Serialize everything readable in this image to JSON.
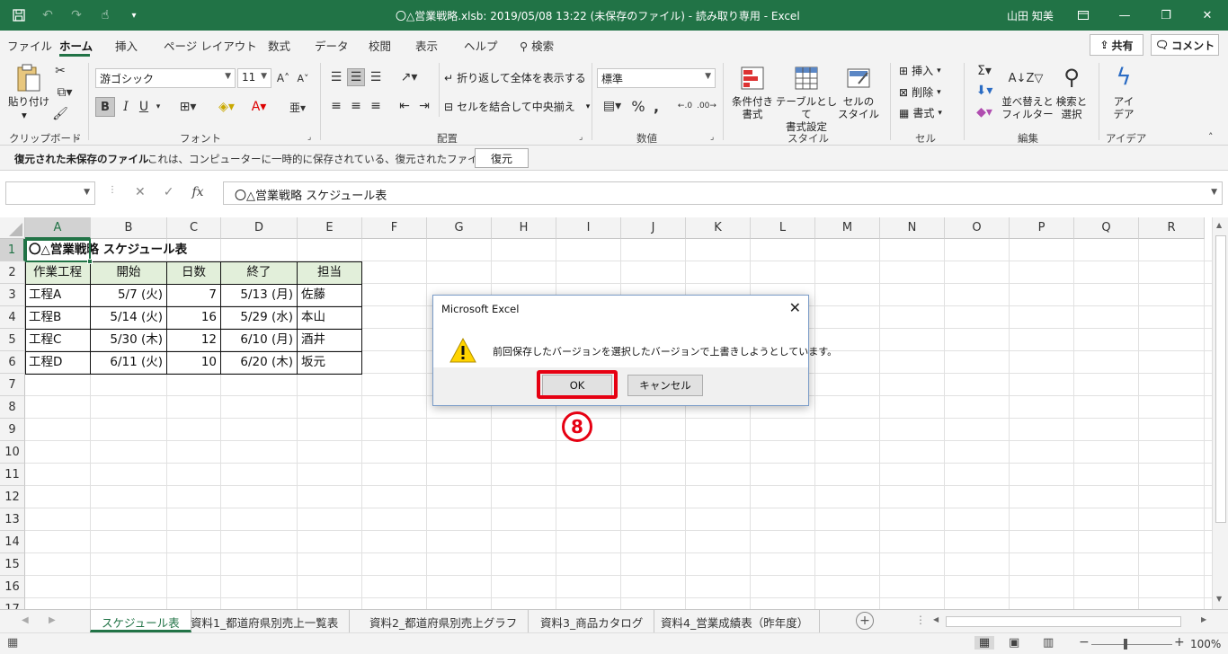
{
  "window": {
    "title": "〇△営業戦略.xlsb: 2019/05/08 13:22 (未保存のファイル) - 読み取り専用 - Excel",
    "user": "山田 知美"
  },
  "tabs": [
    "ファイル",
    "ホーム",
    "挿入",
    "ページ レイアウト",
    "数式",
    "データ",
    "校閲",
    "表示",
    "ヘルプ",
    "検索"
  ],
  "share_label": "共有",
  "comment_label": "コメント",
  "ribbon": {
    "clipboard": {
      "paste": "貼り付け",
      "group": "クリップボード"
    },
    "font": {
      "name": "游ゴシック",
      "size": "11",
      "group": "フォント",
      "bold": "B",
      "italic": "I",
      "underline": "U"
    },
    "alignment": {
      "wrap": "折り返して全体を表示する",
      "merge": "セルを結合して中央揃え",
      "group": "配置"
    },
    "number": {
      "format": "標準",
      "group": "数値"
    },
    "styles": {
      "conditional": "条件付き\n書式",
      "table": "テーブルとして\n書式設定",
      "cell": "セルの\nスタイル",
      "group": "スタイル"
    },
    "cells": {
      "insert": "挿入",
      "delete": "削除",
      "format": "書式",
      "group": "セル"
    },
    "editing": {
      "sort": "並べ替えと\nフィルター",
      "find": "検索と\n選択",
      "group": "編集"
    },
    "ideas": {
      "label": "アイ\nデア",
      "group": "アイデア"
    }
  },
  "infobar": {
    "title": "復元された未保存のファイル",
    "message": "これは、コンピューターに一時的に保存されている、復元されたファイルです。",
    "restore": "復元"
  },
  "formula_bar": {
    "content": "〇△営業戦略 スケジュール表"
  },
  "columns": [
    "A",
    "B",
    "C",
    "D",
    "E",
    "F",
    "G",
    "H",
    "I",
    "J",
    "K",
    "L",
    "M",
    "N",
    "O",
    "P",
    "Q",
    "R"
  ],
  "rows": [
    "1",
    "2",
    "3",
    "4",
    "5",
    "6",
    "7",
    "8",
    "9",
    "10",
    "11",
    "12",
    "13",
    "14",
    "15",
    "16",
    "17"
  ],
  "sheet": {
    "title": "〇△営業戦略 スケジュール表",
    "headers": [
      "作業工程",
      "開始",
      "日数",
      "終了",
      "担当"
    ],
    "data": [
      [
        "工程A",
        "5/7 (火)",
        "7",
        "5/13 (月)",
        "佐藤"
      ],
      [
        "工程B",
        "5/14 (火)",
        "16",
        "5/29 (水)",
        "本山"
      ],
      [
        "工程C",
        "5/30 (木)",
        "12",
        "6/10 (月)",
        "酒井"
      ],
      [
        "工程D",
        "6/11 (火)",
        "10",
        "6/20 (木)",
        "坂元"
      ]
    ]
  },
  "sheet_tabs": [
    "スケジュール表",
    "資料1_都道府県別売上一覧表",
    "資料2_都道府県別売上グラフ",
    "資料3_商品カタログ",
    "資料4_営業成績表（昨年度）"
  ],
  "status": {
    "zoom": "100%"
  },
  "dialog": {
    "title": "Microsoft Excel",
    "message": "前回保存したバージョンを選択したバージョンで上書きしようとしています。",
    "ok": "OK",
    "cancel": "キャンセル"
  },
  "annotation": {
    "step": "8"
  },
  "colors": {
    "excel_green": "#217346",
    "highlight_red": "#e60012"
  }
}
